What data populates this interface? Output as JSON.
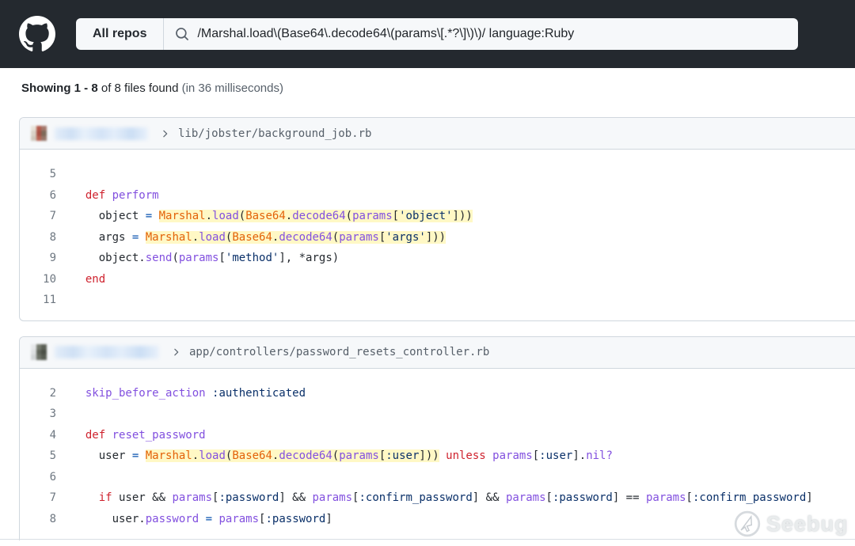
{
  "header": {
    "scope_label": "All repos",
    "search_query": "/Marshal.load\\(Base64\\.decode64\\(params\\[.*?\\]\\)\\)/ language:Ruby"
  },
  "summary": {
    "showing": "Showing 1 - 8",
    "rest": " of 8 files found ",
    "timing": "(in 36 milliseconds)"
  },
  "watermark": {
    "label": "Seebug"
  },
  "colors": {
    "header_bg": "#24292f",
    "searchbar_bg": "#f6f8fa",
    "card_border": "#d0d7de",
    "card_head_bg": "#f6f8fa",
    "match_highlight": "#fff8c5",
    "keyword": "#cf222e",
    "method": "#8250df",
    "constant": "#e36209",
    "string_symbol": "#0a3069",
    "operator": "#0550ae",
    "plain_text": "#24292f",
    "line_number": "#6e7781"
  },
  "results": [
    {
      "path": "lib/jobster/background_job.rb",
      "avatar_pixels": [
        "#e7e2d8",
        "#b3594a",
        "#a3786c",
        "#d9d2c6",
        "#a84f41",
        "#7e6a59",
        "#cfc7bb",
        "#b96352",
        "#96776a"
      ],
      "name_blur_width": 118,
      "lines": [
        {
          "no": "5",
          "tokens": []
        },
        {
          "no": "6",
          "tokens": [
            [
              "pl",
              "  "
            ],
            [
              "k",
              "def"
            ],
            [
              "pl",
              " "
            ],
            [
              "en",
              "perform"
            ]
          ]
        },
        {
          "no": "7",
          "tokens": [
            [
              "pl",
              "    object "
            ],
            [
              "op",
              "="
            ],
            [
              "pl",
              " "
            ],
            [
              "c",
              "Marshal",
              1
            ],
            [
              "pl",
              ".",
              1
            ],
            [
              "en",
              "load",
              1
            ],
            [
              "pl",
              "(",
              1
            ],
            [
              "c",
              "Base64",
              1
            ],
            [
              "pl",
              ".",
              1
            ],
            [
              "en",
              "decode64",
              1
            ],
            [
              "pl",
              "(",
              1
            ],
            [
              "en",
              "params",
              1
            ],
            [
              "pl",
              "[",
              1
            ],
            [
              "s",
              "'object'",
              1
            ],
            [
              "pl",
              "]))",
              1
            ]
          ]
        },
        {
          "no": "8",
          "tokens": [
            [
              "pl",
              "    args "
            ],
            [
              "op",
              "="
            ],
            [
              "pl",
              " "
            ],
            [
              "c",
              "Marshal",
              1
            ],
            [
              "pl",
              ".",
              1
            ],
            [
              "en",
              "load",
              1
            ],
            [
              "pl",
              "(",
              1
            ],
            [
              "c",
              "Base64",
              1
            ],
            [
              "pl",
              ".",
              1
            ],
            [
              "en",
              "decode64",
              1
            ],
            [
              "pl",
              "(",
              1
            ],
            [
              "en",
              "params",
              1
            ],
            [
              "pl",
              "[",
              1
            ],
            [
              "s",
              "'args'",
              1
            ],
            [
              "pl",
              "]))",
              1
            ]
          ]
        },
        {
          "no": "9",
          "tokens": [
            [
              "pl",
              "    object."
            ],
            [
              "en",
              "send"
            ],
            [
              "pl",
              "("
            ],
            [
              "en",
              "params"
            ],
            [
              "pl",
              "["
            ],
            [
              "s",
              "'method'"
            ],
            [
              "pl",
              "], *args)"
            ]
          ]
        },
        {
          "no": "10",
          "tokens": [
            [
              "pl",
              "  "
            ],
            [
              "k",
              "end"
            ]
          ]
        },
        {
          "no": "11",
          "tokens": []
        }
      ]
    },
    {
      "path": "app/controllers/password_resets_controller.rb",
      "avatar_pixels": [
        "#e6e8ea",
        "#767b6f",
        "#5a5f55",
        "#dde0e2",
        "#60655b",
        "#4b5046",
        "#d2d5d7",
        "#6d7268",
        "#585d53"
      ],
      "name_blur_width": 132,
      "lines": [
        {
          "no": "2",
          "tokens": [
            [
              "pl",
              "  "
            ],
            [
              "en",
              "skip_before_action"
            ],
            [
              "pl",
              " "
            ],
            [
              "s",
              ":authenticated"
            ]
          ]
        },
        {
          "no": "3",
          "tokens": []
        },
        {
          "no": "4",
          "tokens": [
            [
              "pl",
              "  "
            ],
            [
              "k",
              "def"
            ],
            [
              "pl",
              " "
            ],
            [
              "en",
              "reset_password"
            ]
          ]
        },
        {
          "no": "5",
          "tokens": [
            [
              "pl",
              "    user "
            ],
            [
              "op",
              "="
            ],
            [
              "pl",
              " "
            ],
            [
              "c",
              "Marshal",
              1
            ],
            [
              "pl",
              ".",
              1
            ],
            [
              "en",
              "load",
              1
            ],
            [
              "pl",
              "(",
              1
            ],
            [
              "c",
              "Base64",
              1
            ],
            [
              "pl",
              ".",
              1
            ],
            [
              "en",
              "decode64",
              1
            ],
            [
              "pl",
              "(",
              1
            ],
            [
              "en",
              "params",
              1
            ],
            [
              "pl",
              "[",
              1
            ],
            [
              "s",
              ":user",
              1
            ],
            [
              "pl",
              "]))",
              1
            ],
            [
              "pl",
              " "
            ],
            [
              "k",
              "unless"
            ],
            [
              "pl",
              " "
            ],
            [
              "en",
              "params"
            ],
            [
              "pl",
              "["
            ],
            [
              "s",
              ":user"
            ],
            [
              "pl",
              "]."
            ],
            [
              "en",
              "nil?"
            ]
          ]
        },
        {
          "no": "6",
          "tokens": []
        },
        {
          "no": "7",
          "tokens": [
            [
              "pl",
              "    "
            ],
            [
              "k",
              "if"
            ],
            [
              "pl",
              " user && "
            ],
            [
              "en",
              "params"
            ],
            [
              "pl",
              "["
            ],
            [
              "s",
              ":password"
            ],
            [
              "pl",
              "] && "
            ],
            [
              "en",
              "params"
            ],
            [
              "pl",
              "["
            ],
            [
              "s",
              ":confirm_password"
            ],
            [
              "pl",
              "] && "
            ],
            [
              "en",
              "params"
            ],
            [
              "pl",
              "["
            ],
            [
              "s",
              ":password"
            ],
            [
              "pl",
              "] == "
            ],
            [
              "en",
              "params"
            ],
            [
              "pl",
              "["
            ],
            [
              "s",
              ":confirm_password"
            ],
            [
              "pl",
              "]"
            ]
          ]
        },
        {
          "no": "8",
          "tokens": [
            [
              "pl",
              "      user."
            ],
            [
              "en",
              "password"
            ],
            [
              "pl",
              " "
            ],
            [
              "op",
              "="
            ],
            [
              "pl",
              " "
            ],
            [
              "en",
              "params"
            ],
            [
              "pl",
              "["
            ],
            [
              "s",
              ":password"
            ],
            [
              "pl",
              "]"
            ]
          ]
        }
      ]
    }
  ]
}
